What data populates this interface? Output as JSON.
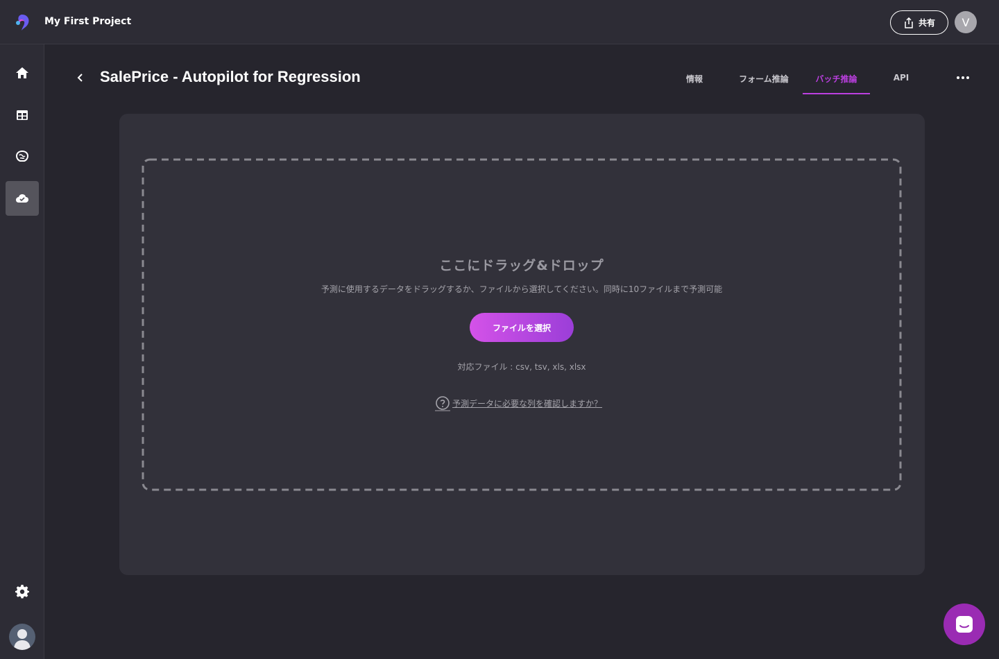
{
  "app": {
    "project_name": "My First Project",
    "share_label": "共有",
    "user_initial": "V"
  },
  "sidebar": {
    "items": [
      {
        "icon": "home-icon"
      },
      {
        "icon": "table-icon"
      },
      {
        "icon": "brain-icon"
      },
      {
        "icon": "cloud-check-icon",
        "active": true
      }
    ],
    "settings_icon": "gear-icon"
  },
  "header": {
    "title": "SalePrice - Autopilot for Regression",
    "tabs": [
      {
        "label": "情報"
      },
      {
        "label": "フォーム推論"
      },
      {
        "label": "バッチ推論",
        "active": true
      },
      {
        "label": "API"
      }
    ]
  },
  "dropzone": {
    "title": "ここにドラッグ&ドロップ",
    "description": "予測に使用するデータをドラッグするか、ファイルから選択してください。同時に10ファイルまで予測可能",
    "button_label": "ファイルを選択",
    "formats": "対応ファイル : csv, tsv, xls, xlsx",
    "help_link": "予測データに必要な列を確認しますか？"
  },
  "colors": {
    "accent": "#bb3fe0",
    "background": "#26252d",
    "card": "#32313a",
    "chat": "#9a2bb3"
  }
}
